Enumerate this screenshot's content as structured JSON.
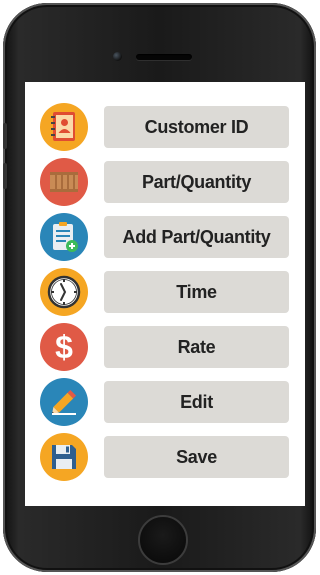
{
  "menu": {
    "items": [
      {
        "label": "Customer ID",
        "icon": "contact-book-icon",
        "icon_bg": "#f5a623"
      },
      {
        "label": "Part/Quantity",
        "icon": "crate-icon",
        "icon_bg": "#e05a46"
      },
      {
        "label": "Add Part/Quantity",
        "icon": "clipboard-add-icon",
        "icon_bg": "#2a86b8"
      },
      {
        "label": "Time",
        "icon": "clock-icon",
        "icon_bg": "#f5a623"
      },
      {
        "label": "Rate",
        "icon": "dollar-icon",
        "icon_bg": "#e05a46"
      },
      {
        "label": "Edit",
        "icon": "pencil-icon",
        "icon_bg": "#2a86b8"
      },
      {
        "label": "Save",
        "icon": "floppy-disk-icon",
        "icon_bg": "#f5a623"
      }
    ]
  },
  "colors": {
    "button_bg": "#dcdad6",
    "button_text": "#222222",
    "phone_body": "#1a1a1a",
    "screen_bg": "#ffffff"
  }
}
